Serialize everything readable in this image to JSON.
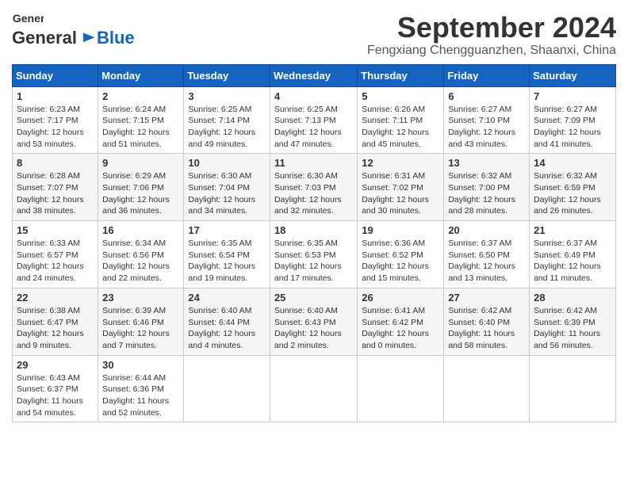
{
  "header": {
    "logo_general": "General",
    "logo_blue": "Blue",
    "month": "September 2024",
    "location": "Fengxiang Chengguanzhen, Shaanxi, China"
  },
  "weekdays": [
    "Sunday",
    "Monday",
    "Tuesday",
    "Wednesday",
    "Thursday",
    "Friday",
    "Saturday"
  ],
  "weeks": [
    [
      {
        "day": "1",
        "sunrise": "Sunrise: 6:23 AM",
        "sunset": "Sunset: 7:17 PM",
        "daylight": "Daylight: 12 hours and 53 minutes."
      },
      {
        "day": "2",
        "sunrise": "Sunrise: 6:24 AM",
        "sunset": "Sunset: 7:15 PM",
        "daylight": "Daylight: 12 hours and 51 minutes."
      },
      {
        "day": "3",
        "sunrise": "Sunrise: 6:25 AM",
        "sunset": "Sunset: 7:14 PM",
        "daylight": "Daylight: 12 hours and 49 minutes."
      },
      {
        "day": "4",
        "sunrise": "Sunrise: 6:25 AM",
        "sunset": "Sunset: 7:13 PM",
        "daylight": "Daylight: 12 hours and 47 minutes."
      },
      {
        "day": "5",
        "sunrise": "Sunrise: 6:26 AM",
        "sunset": "Sunset: 7:11 PM",
        "daylight": "Daylight: 12 hours and 45 minutes."
      },
      {
        "day": "6",
        "sunrise": "Sunrise: 6:27 AM",
        "sunset": "Sunset: 7:10 PM",
        "daylight": "Daylight: 12 hours and 43 minutes."
      },
      {
        "day": "7",
        "sunrise": "Sunrise: 6:27 AM",
        "sunset": "Sunset: 7:09 PM",
        "daylight": "Daylight: 12 hours and 41 minutes."
      }
    ],
    [
      {
        "day": "8",
        "sunrise": "Sunrise: 6:28 AM",
        "sunset": "Sunset: 7:07 PM",
        "daylight": "Daylight: 12 hours and 38 minutes."
      },
      {
        "day": "9",
        "sunrise": "Sunrise: 6:29 AM",
        "sunset": "Sunset: 7:06 PM",
        "daylight": "Daylight: 12 hours and 36 minutes."
      },
      {
        "day": "10",
        "sunrise": "Sunrise: 6:30 AM",
        "sunset": "Sunset: 7:04 PM",
        "daylight": "Daylight: 12 hours and 34 minutes."
      },
      {
        "day": "11",
        "sunrise": "Sunrise: 6:30 AM",
        "sunset": "Sunset: 7:03 PM",
        "daylight": "Daylight: 12 hours and 32 minutes."
      },
      {
        "day": "12",
        "sunrise": "Sunrise: 6:31 AM",
        "sunset": "Sunset: 7:02 PM",
        "daylight": "Daylight: 12 hours and 30 minutes."
      },
      {
        "day": "13",
        "sunrise": "Sunrise: 6:32 AM",
        "sunset": "Sunset: 7:00 PM",
        "daylight": "Daylight: 12 hours and 28 minutes."
      },
      {
        "day": "14",
        "sunrise": "Sunrise: 6:32 AM",
        "sunset": "Sunset: 6:59 PM",
        "daylight": "Daylight: 12 hours and 26 minutes."
      }
    ],
    [
      {
        "day": "15",
        "sunrise": "Sunrise: 6:33 AM",
        "sunset": "Sunset: 6:57 PM",
        "daylight": "Daylight: 12 hours and 24 minutes."
      },
      {
        "day": "16",
        "sunrise": "Sunrise: 6:34 AM",
        "sunset": "Sunset: 6:56 PM",
        "daylight": "Daylight: 12 hours and 22 minutes."
      },
      {
        "day": "17",
        "sunrise": "Sunrise: 6:35 AM",
        "sunset": "Sunset: 6:54 PM",
        "daylight": "Daylight: 12 hours and 19 minutes."
      },
      {
        "day": "18",
        "sunrise": "Sunrise: 6:35 AM",
        "sunset": "Sunset: 6:53 PM",
        "daylight": "Daylight: 12 hours and 17 minutes."
      },
      {
        "day": "19",
        "sunrise": "Sunrise: 6:36 AM",
        "sunset": "Sunset: 6:52 PM",
        "daylight": "Daylight: 12 hours and 15 minutes."
      },
      {
        "day": "20",
        "sunrise": "Sunrise: 6:37 AM",
        "sunset": "Sunset: 6:50 PM",
        "daylight": "Daylight: 12 hours and 13 minutes."
      },
      {
        "day": "21",
        "sunrise": "Sunrise: 6:37 AM",
        "sunset": "Sunset: 6:49 PM",
        "daylight": "Daylight: 12 hours and 11 minutes."
      }
    ],
    [
      {
        "day": "22",
        "sunrise": "Sunrise: 6:38 AM",
        "sunset": "Sunset: 6:47 PM",
        "daylight": "Daylight: 12 hours and 9 minutes."
      },
      {
        "day": "23",
        "sunrise": "Sunrise: 6:39 AM",
        "sunset": "Sunset: 6:46 PM",
        "daylight": "Daylight: 12 hours and 7 minutes."
      },
      {
        "day": "24",
        "sunrise": "Sunrise: 6:40 AM",
        "sunset": "Sunset: 6:44 PM",
        "daylight": "Daylight: 12 hours and 4 minutes."
      },
      {
        "day": "25",
        "sunrise": "Sunrise: 6:40 AM",
        "sunset": "Sunset: 6:43 PM",
        "daylight": "Daylight: 12 hours and 2 minutes."
      },
      {
        "day": "26",
        "sunrise": "Sunrise: 6:41 AM",
        "sunset": "Sunset: 6:42 PM",
        "daylight": "Daylight: 12 hours and 0 minutes."
      },
      {
        "day": "27",
        "sunrise": "Sunrise: 6:42 AM",
        "sunset": "Sunset: 6:40 PM",
        "daylight": "Daylight: 11 hours and 58 minutes."
      },
      {
        "day": "28",
        "sunrise": "Sunrise: 6:42 AM",
        "sunset": "Sunset: 6:39 PM",
        "daylight": "Daylight: 11 hours and 56 minutes."
      }
    ],
    [
      {
        "day": "29",
        "sunrise": "Sunrise: 6:43 AM",
        "sunset": "Sunset: 6:37 PM",
        "daylight": "Daylight: 11 hours and 54 minutes."
      },
      {
        "day": "30",
        "sunrise": "Sunrise: 6:44 AM",
        "sunset": "Sunset: 6:36 PM",
        "daylight": "Daylight: 11 hours and 52 minutes."
      },
      null,
      null,
      null,
      null,
      null
    ]
  ]
}
